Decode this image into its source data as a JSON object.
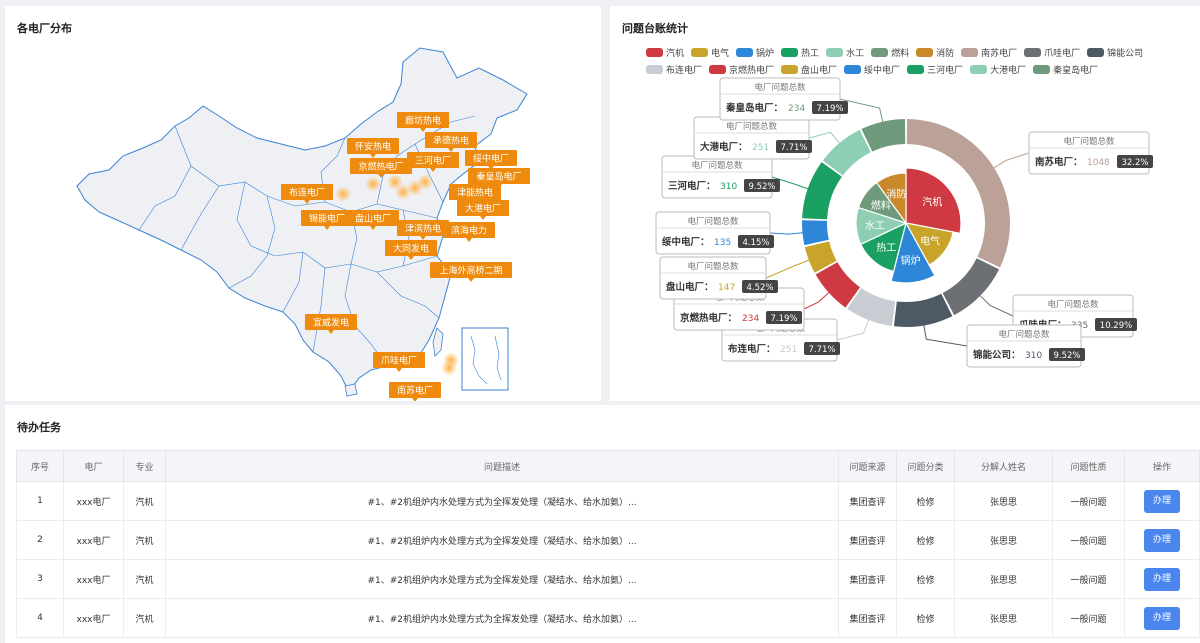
{
  "map": {
    "title": "各电厂分布",
    "markers": [
      {
        "name": "廊坊热电"
      },
      {
        "name": "怀安热电"
      },
      {
        "name": "承德热电"
      },
      {
        "name": "三河电厂"
      },
      {
        "name": "京燃热电厂"
      },
      {
        "name": "绥中电厂"
      },
      {
        "name": "秦皇岛电厂"
      },
      {
        "name": "布连电厂"
      },
      {
        "name": "津能热电"
      },
      {
        "name": "锦能电厂"
      },
      {
        "name": "盘山电厂"
      },
      {
        "name": "大港电厂"
      },
      {
        "name": "津滨热电"
      },
      {
        "name": "滨海电力"
      },
      {
        "name": "大同发电"
      },
      {
        "name": "上海外高桥二期"
      },
      {
        "name": "宣威发电"
      },
      {
        "name": "爪哇电厂"
      },
      {
        "name": "南苏电厂"
      }
    ]
  },
  "stats": {
    "title": "问题台账统计",
    "callout_title": "电厂问题总数"
  },
  "chart_data": {
    "type": "pie",
    "legend": [
      {
        "name": "汽机",
        "color": "#cf3a42"
      },
      {
        "name": "电气",
        "color": "#c9a42a"
      },
      {
        "name": "锅炉",
        "color": "#2d86d8"
      },
      {
        "name": "热工",
        "color": "#1aa063"
      },
      {
        "name": "水工",
        "color": "#8ecfb3"
      },
      {
        "name": "燃料",
        "color": "#6f9b7c"
      },
      {
        "name": "消防",
        "color": "#c9892a"
      },
      {
        "name": "南苏电厂",
        "color": "#bba197"
      },
      {
        "name": "爪哇电厂",
        "color": "#6c6f73"
      },
      {
        "name": "锦能公司",
        "color": "#4d5a66"
      },
      {
        "name": "布连电厂",
        "color": "#c7cdd3"
      },
      {
        "name": "京燃热电厂",
        "color": "#cf3a42"
      },
      {
        "name": "盘山电厂",
        "color": "#c9a42a"
      },
      {
        "name": "绥中电厂",
        "color": "#2d86d8"
      },
      {
        "name": "三河电厂",
        "color": "#1aa063"
      },
      {
        "name": "大港电厂",
        "color": "#8ecfb3"
      },
      {
        "name": "秦皇岛电厂",
        "color": "#6f9b7c"
      }
    ],
    "inner": [
      {
        "name": "汽机",
        "value": 28,
        "color": "#cf3a42"
      },
      {
        "name": "电气",
        "value": 14,
        "color": "#c9a42a"
      },
      {
        "name": "锅炉",
        "value": 12,
        "color": "#2d86d8"
      },
      {
        "name": "热工",
        "value": 14,
        "color": "#1aa063"
      },
      {
        "name": "水工",
        "value": 12,
        "color": "#8ecfb3"
      },
      {
        "name": "燃料",
        "value": 10,
        "color": "#6f9b7c"
      },
      {
        "name": "消防",
        "value": 10,
        "color": "#c9892a"
      }
    ],
    "outer": [
      {
        "name": "南苏电厂",
        "label": "南苏电厂：",
        "value": 1048,
        "percent": "32.2%",
        "color": "#bba197"
      },
      {
        "name": "爪哇电厂",
        "label": "爪哇电厂：",
        "value": 335,
        "percent": "10.29%",
        "color": "#6c6f73"
      },
      {
        "name": "锦能公司",
        "label": "锦能公司：",
        "value": 310,
        "percent": "9.52%",
        "color": "#4d5a66"
      },
      {
        "name": "布连电厂",
        "label": "布连电厂：",
        "value": 251,
        "percent": "7.71%",
        "color": "#c7cdd3"
      },
      {
        "name": "京燃热电厂",
        "label": "京燃热电厂：",
        "value": 234,
        "percent": "7.19%",
        "color": "#cf3a42"
      },
      {
        "name": "盘山电厂",
        "label": "盘山电厂：",
        "value": 147,
        "percent": "4.52%",
        "color": "#c9a42a"
      },
      {
        "name": "绥中电厂",
        "label": "绥中电厂：",
        "value": 135,
        "percent": "4.15%",
        "color": "#2d86d8"
      },
      {
        "name": "三河电厂",
        "label": "三河电厂：",
        "value": 310,
        "percent": "9.52%",
        "color": "#1aa063"
      },
      {
        "name": "大港电厂",
        "label": "大港电厂：",
        "value": 251,
        "percent": "7.71%",
        "color": "#8ecfb3"
      },
      {
        "name": "秦皇岛电厂",
        "label": "秦皇岛电厂：",
        "value": 234,
        "percent": "7.19%",
        "color": "#6f9b7c"
      }
    ]
  },
  "tasks": {
    "title": "待办任务",
    "columns": [
      "序号",
      "电厂",
      "专业",
      "问题描述",
      "问题来源",
      "问题分类",
      "分解人姓名",
      "问题性质",
      "操作"
    ],
    "rows": [
      {
        "no": "1",
        "plant": "xxx电厂",
        "major": "汽机",
        "desc": "#1、#2机组炉内水处理方式为全挥发处理（凝结水、给水加氨）...",
        "source": "集团查评",
        "category": "检修",
        "person": "张思思",
        "nature": "一般问题",
        "action": "办理"
      },
      {
        "no": "2",
        "plant": "xxx电厂",
        "major": "汽机",
        "desc": "#1、#2机组炉内水处理方式为全挥发处理（凝结水、给水加氨）...",
        "source": "集团查评",
        "category": "检修",
        "person": "张思思",
        "nature": "一般问题",
        "action": "办理"
      },
      {
        "no": "3",
        "plant": "xxx电厂",
        "major": "汽机",
        "desc": "#1、#2机组炉内水处理方式为全挥发处理（凝结水、给水加氨）...",
        "source": "集团查评",
        "category": "检修",
        "person": "张思思",
        "nature": "一般问题",
        "action": "办理"
      },
      {
        "no": "4",
        "plant": "xxx电厂",
        "major": "汽机",
        "desc": "#1、#2机组炉内水处理方式为全挥发处理（凝结水、给水加氨）...",
        "source": "集团查评",
        "category": "检修",
        "person": "张思思",
        "nature": "一般问题",
        "action": "办理"
      }
    ]
  }
}
